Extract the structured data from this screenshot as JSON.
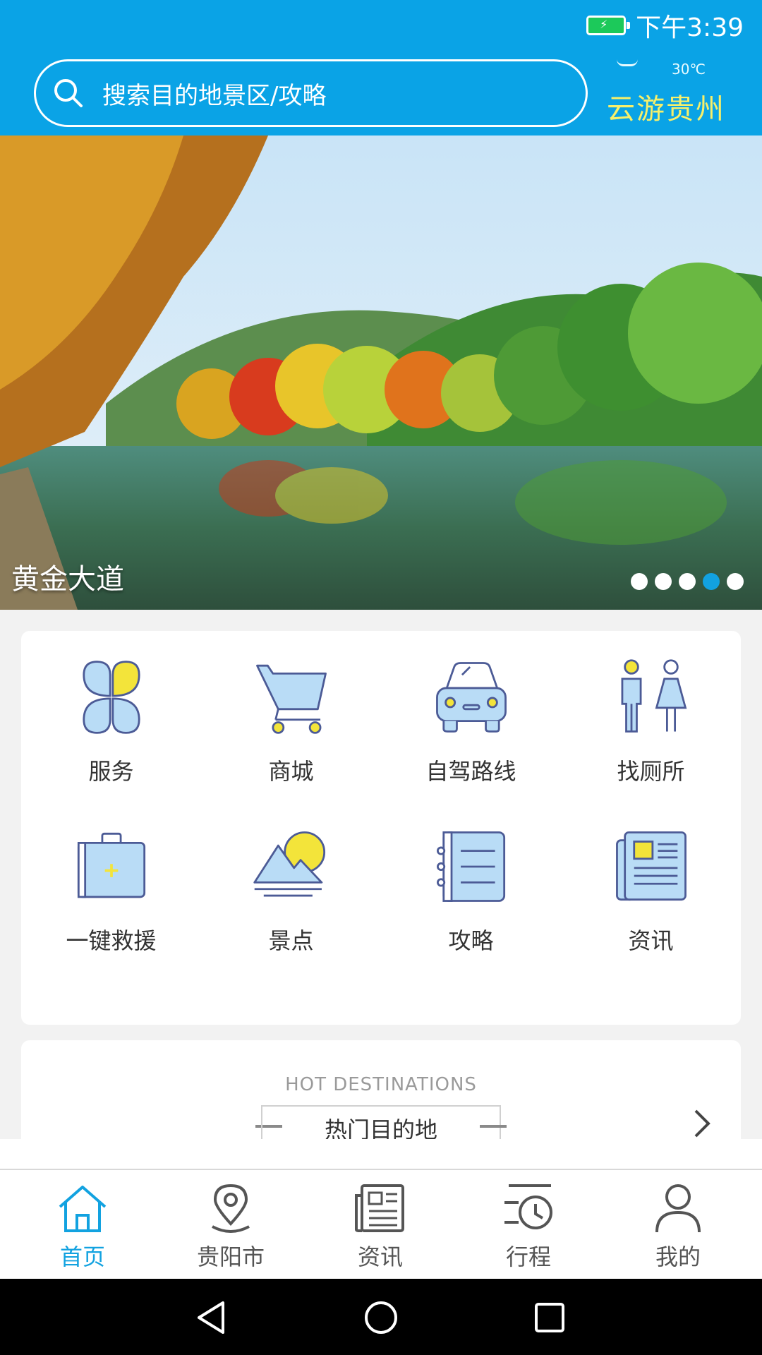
{
  "status": {
    "time": "下午3:39"
  },
  "search": {
    "placeholder": "搜索目的地景区/攻略"
  },
  "weather": {
    "temperature": "30℃",
    "brand": "云游贵州"
  },
  "banner": {
    "caption": "黄金大道",
    "dots_total": 5,
    "active_dot": 4
  },
  "grid": {
    "items": [
      {
        "label": "服务",
        "icon": "clover-icon"
      },
      {
        "label": "商城",
        "icon": "cart-icon"
      },
      {
        "label": "自驾路线",
        "icon": "car-icon"
      },
      {
        "label": "找厕所",
        "icon": "restroom-icon"
      },
      {
        "label": "一键救援",
        "icon": "first-aid-icon"
      },
      {
        "label": "景点",
        "icon": "mountain-sun-icon"
      },
      {
        "label": "攻略",
        "icon": "notebook-icon"
      },
      {
        "label": "资讯",
        "icon": "newspaper-icon"
      }
    ]
  },
  "hot": {
    "en_title": "HOT DESTINATIONS",
    "zh_title": "热门目的地"
  },
  "tabbar": {
    "tabs": [
      {
        "label": "首页",
        "icon": "home-icon",
        "active": true
      },
      {
        "label": "贵阳市",
        "icon": "location-pin-icon",
        "active": false
      },
      {
        "label": "资讯",
        "icon": "news-icon",
        "active": false
      },
      {
        "label": "行程",
        "icon": "itinerary-clock-icon",
        "active": false
      },
      {
        "label": "我的",
        "icon": "person-icon",
        "active": false
      }
    ]
  },
  "colors": {
    "header": "#0aa3e6",
    "brand": "#f7f06a",
    "accent": "#12a2e0",
    "icon_fill": "#b9dcf6",
    "icon_stroke": "#4c5b96",
    "icon_yellow": "#f3e43a"
  }
}
